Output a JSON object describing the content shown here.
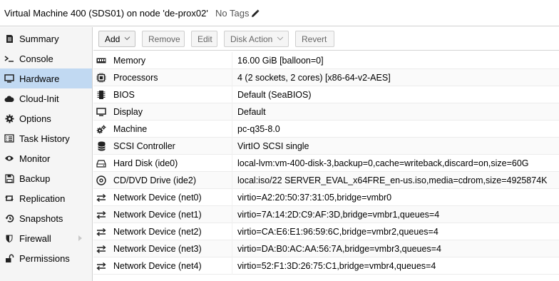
{
  "header": {
    "vm_title": "Virtual Machine 400 (SDS01) on node 'de-prox02'",
    "tags_label": "No Tags"
  },
  "sidebar": {
    "items": [
      {
        "label": "Summary",
        "icon": "summary-icon"
      },
      {
        "label": "Console",
        "icon": "console-icon"
      },
      {
        "label": "Hardware",
        "icon": "hardware-icon",
        "active": true
      },
      {
        "label": "Cloud-Init",
        "icon": "cloud-icon"
      },
      {
        "label": "Options",
        "icon": "gear-icon"
      },
      {
        "label": "Task History",
        "icon": "task-history-icon"
      },
      {
        "label": "Monitor",
        "icon": "eye-icon"
      },
      {
        "label": "Backup",
        "icon": "floppy-icon"
      },
      {
        "label": "Replication",
        "icon": "retweet-icon"
      },
      {
        "label": "Snapshots",
        "icon": "history-icon"
      },
      {
        "label": "Firewall",
        "icon": "shield-icon"
      },
      {
        "label": "Permissions",
        "icon": "unlock-icon"
      }
    ]
  },
  "toolbar": {
    "add_label": "Add",
    "remove_label": "Remove",
    "edit_label": "Edit",
    "disk_action_label": "Disk Action",
    "revert_label": "Revert"
  },
  "hardware": {
    "rows": [
      {
        "label": "Memory",
        "value": "16.00 GiB [balloon=0]",
        "icon": "memory-icon"
      },
      {
        "label": "Processors",
        "value": "4 (2 sockets, 2 cores) [x86-64-v2-AES]",
        "icon": "cpu-icon"
      },
      {
        "label": "BIOS",
        "value": "Default (SeaBIOS)",
        "icon": "microchip-icon"
      },
      {
        "label": "Display",
        "value": "Default",
        "icon": "desktop-icon"
      },
      {
        "label": "Machine",
        "value": "pc-q35-8.0",
        "icon": "cogs-icon"
      },
      {
        "label": "SCSI Controller",
        "value": "VirtIO SCSI single",
        "icon": "database-icon"
      },
      {
        "label": "Hard Disk (ide0)",
        "value": "local-lvm:vm-400-disk-3,backup=0,cache=writeback,discard=on,size=60G",
        "icon": "hdd-icon"
      },
      {
        "label": "CD/DVD Drive (ide2)",
        "value": "local:iso/22 SERVER_EVAL_x64FRE_en-us.iso,media=cdrom,size=4925874K",
        "icon": "cdrom-icon"
      },
      {
        "label": "Network Device (net0)",
        "value": "virtio=A2:20:50:37:31:05,bridge=vmbr0",
        "icon": "exchange-icon"
      },
      {
        "label": "Network Device (net1)",
        "value": "virtio=7A:14:2D:C9:AF:3D,bridge=vmbr1,queues=4",
        "icon": "exchange-icon"
      },
      {
        "label": "Network Device (net2)",
        "value": "virtio=CA:E6:E1:96:59:6C,bridge=vmbr2,queues=4",
        "icon": "exchange-icon"
      },
      {
        "label": "Network Device (net3)",
        "value": "virtio=DA:B0:AC:AA:56:7A,bridge=vmbr3,queues=4",
        "icon": "exchange-icon"
      },
      {
        "label": "Network Device (net4)",
        "value": "virtio=52:F1:3D:26:75:C1,bridge=vmbr4,queues=4",
        "icon": "exchange-icon"
      }
    ]
  },
  "colors": {
    "active_nav": "#c1d9f2",
    "sidebar_bg": "#f5f5f5"
  }
}
